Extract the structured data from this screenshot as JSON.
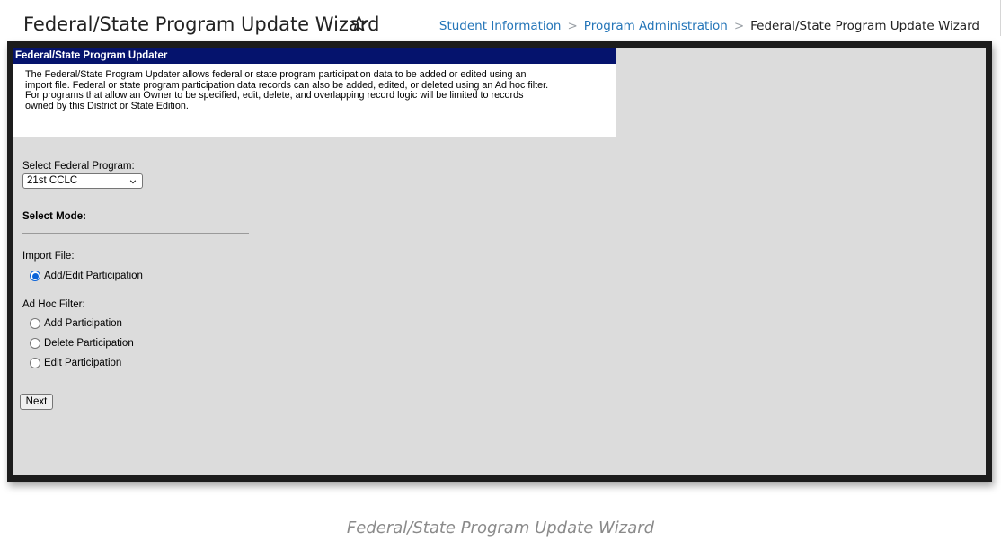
{
  "header": {
    "title": "Federal/State Program Update Wizard",
    "star_icon": "star-outline-icon",
    "breadcrumb": [
      "Student Information",
      "Program Administration",
      "Federal/State Program Update Wizard"
    ],
    "colors": {
      "link": "#2475b8",
      "panel_header": "#05136d",
      "radio_selected": "#0b63d8"
    }
  },
  "panel": {
    "title": "Federal/State Program Updater",
    "lines": [
      "The Federal/State Program Updater allows federal or state program participation data to be added or edited using an",
      "import file. Federal or state program participation data records can also be added, edited, or deleted using an Ad hoc filter.",
      "For programs that allow an Owner to be specified, edit, delete, and overlapping record logic will be limited to records",
      "owned by this District or State Edition."
    ]
  },
  "form": {
    "program_label": "Select Federal Program:",
    "program_value": "21st CCLC",
    "mode_label": "Select Mode:",
    "import_label": "Import File:",
    "import_options": [
      {
        "label": "Add/Edit Participation",
        "checked": true
      }
    ],
    "adhoc_label": "Ad Hoc Filter:",
    "adhoc_options": [
      {
        "label": "Add Participation",
        "checked": false
      },
      {
        "label": "Delete Participation",
        "checked": false
      },
      {
        "label": "Edit Participation",
        "checked": false
      }
    ],
    "next_label": "Next"
  },
  "caption": "Federal/State Program Update Wizard"
}
